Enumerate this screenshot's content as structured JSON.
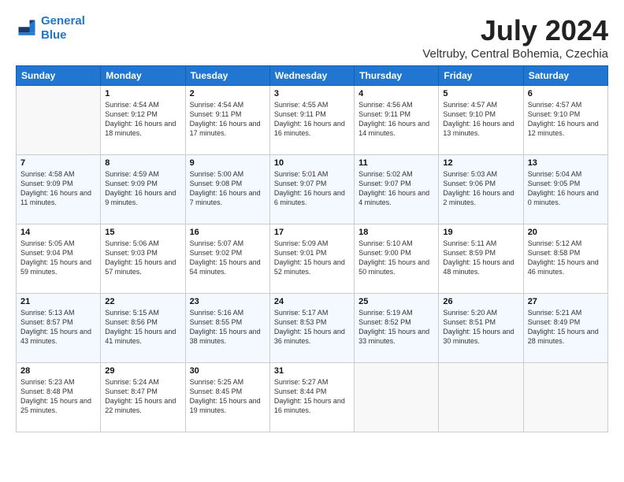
{
  "logo": {
    "line1": "General",
    "line2": "Blue"
  },
  "title": "July 2024",
  "location": "Veltruby, Central Bohemia, Czechia",
  "days_of_week": [
    "Sunday",
    "Monday",
    "Tuesday",
    "Wednesday",
    "Thursday",
    "Friday",
    "Saturday"
  ],
  "weeks": [
    [
      {
        "day": null
      },
      {
        "day": "1",
        "sunrise": "Sunrise: 4:54 AM",
        "sunset": "Sunset: 9:12 PM",
        "daylight": "Daylight: 16 hours and 18 minutes."
      },
      {
        "day": "2",
        "sunrise": "Sunrise: 4:54 AM",
        "sunset": "Sunset: 9:11 PM",
        "daylight": "Daylight: 16 hours and 17 minutes."
      },
      {
        "day": "3",
        "sunrise": "Sunrise: 4:55 AM",
        "sunset": "Sunset: 9:11 PM",
        "daylight": "Daylight: 16 hours and 16 minutes."
      },
      {
        "day": "4",
        "sunrise": "Sunrise: 4:56 AM",
        "sunset": "Sunset: 9:11 PM",
        "daylight": "Daylight: 16 hours and 14 minutes."
      },
      {
        "day": "5",
        "sunrise": "Sunrise: 4:57 AM",
        "sunset": "Sunset: 9:10 PM",
        "daylight": "Daylight: 16 hours and 13 minutes."
      },
      {
        "day": "6",
        "sunrise": "Sunrise: 4:57 AM",
        "sunset": "Sunset: 9:10 PM",
        "daylight": "Daylight: 16 hours and 12 minutes."
      }
    ],
    [
      {
        "day": "7",
        "sunrise": "Sunrise: 4:58 AM",
        "sunset": "Sunset: 9:09 PM",
        "daylight": "Daylight: 16 hours and 11 minutes."
      },
      {
        "day": "8",
        "sunrise": "Sunrise: 4:59 AM",
        "sunset": "Sunset: 9:09 PM",
        "daylight": "Daylight: 16 hours and 9 minutes."
      },
      {
        "day": "9",
        "sunrise": "Sunrise: 5:00 AM",
        "sunset": "Sunset: 9:08 PM",
        "daylight": "Daylight: 16 hours and 7 minutes."
      },
      {
        "day": "10",
        "sunrise": "Sunrise: 5:01 AM",
        "sunset": "Sunset: 9:07 PM",
        "daylight": "Daylight: 16 hours and 6 minutes."
      },
      {
        "day": "11",
        "sunrise": "Sunrise: 5:02 AM",
        "sunset": "Sunset: 9:07 PM",
        "daylight": "Daylight: 16 hours and 4 minutes."
      },
      {
        "day": "12",
        "sunrise": "Sunrise: 5:03 AM",
        "sunset": "Sunset: 9:06 PM",
        "daylight": "Daylight: 16 hours and 2 minutes."
      },
      {
        "day": "13",
        "sunrise": "Sunrise: 5:04 AM",
        "sunset": "Sunset: 9:05 PM",
        "daylight": "Daylight: 16 hours and 0 minutes."
      }
    ],
    [
      {
        "day": "14",
        "sunrise": "Sunrise: 5:05 AM",
        "sunset": "Sunset: 9:04 PM",
        "daylight": "Daylight: 15 hours and 59 minutes."
      },
      {
        "day": "15",
        "sunrise": "Sunrise: 5:06 AM",
        "sunset": "Sunset: 9:03 PM",
        "daylight": "Daylight: 15 hours and 57 minutes."
      },
      {
        "day": "16",
        "sunrise": "Sunrise: 5:07 AM",
        "sunset": "Sunset: 9:02 PM",
        "daylight": "Daylight: 15 hours and 54 minutes."
      },
      {
        "day": "17",
        "sunrise": "Sunrise: 5:09 AM",
        "sunset": "Sunset: 9:01 PM",
        "daylight": "Daylight: 15 hours and 52 minutes."
      },
      {
        "day": "18",
        "sunrise": "Sunrise: 5:10 AM",
        "sunset": "Sunset: 9:00 PM",
        "daylight": "Daylight: 15 hours and 50 minutes."
      },
      {
        "day": "19",
        "sunrise": "Sunrise: 5:11 AM",
        "sunset": "Sunset: 8:59 PM",
        "daylight": "Daylight: 15 hours and 48 minutes."
      },
      {
        "day": "20",
        "sunrise": "Sunrise: 5:12 AM",
        "sunset": "Sunset: 8:58 PM",
        "daylight": "Daylight: 15 hours and 46 minutes."
      }
    ],
    [
      {
        "day": "21",
        "sunrise": "Sunrise: 5:13 AM",
        "sunset": "Sunset: 8:57 PM",
        "daylight": "Daylight: 15 hours and 43 minutes."
      },
      {
        "day": "22",
        "sunrise": "Sunrise: 5:15 AM",
        "sunset": "Sunset: 8:56 PM",
        "daylight": "Daylight: 15 hours and 41 minutes."
      },
      {
        "day": "23",
        "sunrise": "Sunrise: 5:16 AM",
        "sunset": "Sunset: 8:55 PM",
        "daylight": "Daylight: 15 hours and 38 minutes."
      },
      {
        "day": "24",
        "sunrise": "Sunrise: 5:17 AM",
        "sunset": "Sunset: 8:53 PM",
        "daylight": "Daylight: 15 hours and 36 minutes."
      },
      {
        "day": "25",
        "sunrise": "Sunrise: 5:19 AM",
        "sunset": "Sunset: 8:52 PM",
        "daylight": "Daylight: 15 hours and 33 minutes."
      },
      {
        "day": "26",
        "sunrise": "Sunrise: 5:20 AM",
        "sunset": "Sunset: 8:51 PM",
        "daylight": "Daylight: 15 hours and 30 minutes."
      },
      {
        "day": "27",
        "sunrise": "Sunrise: 5:21 AM",
        "sunset": "Sunset: 8:49 PM",
        "daylight": "Daylight: 15 hours and 28 minutes."
      }
    ],
    [
      {
        "day": "28",
        "sunrise": "Sunrise: 5:23 AM",
        "sunset": "Sunset: 8:48 PM",
        "daylight": "Daylight: 15 hours and 25 minutes."
      },
      {
        "day": "29",
        "sunrise": "Sunrise: 5:24 AM",
        "sunset": "Sunset: 8:47 PM",
        "daylight": "Daylight: 15 hours and 22 minutes."
      },
      {
        "day": "30",
        "sunrise": "Sunrise: 5:25 AM",
        "sunset": "Sunset: 8:45 PM",
        "daylight": "Daylight: 15 hours and 19 minutes."
      },
      {
        "day": "31",
        "sunrise": "Sunrise: 5:27 AM",
        "sunset": "Sunset: 8:44 PM",
        "daylight": "Daylight: 15 hours and 16 minutes."
      },
      {
        "day": null
      },
      {
        "day": null
      },
      {
        "day": null
      }
    ]
  ]
}
